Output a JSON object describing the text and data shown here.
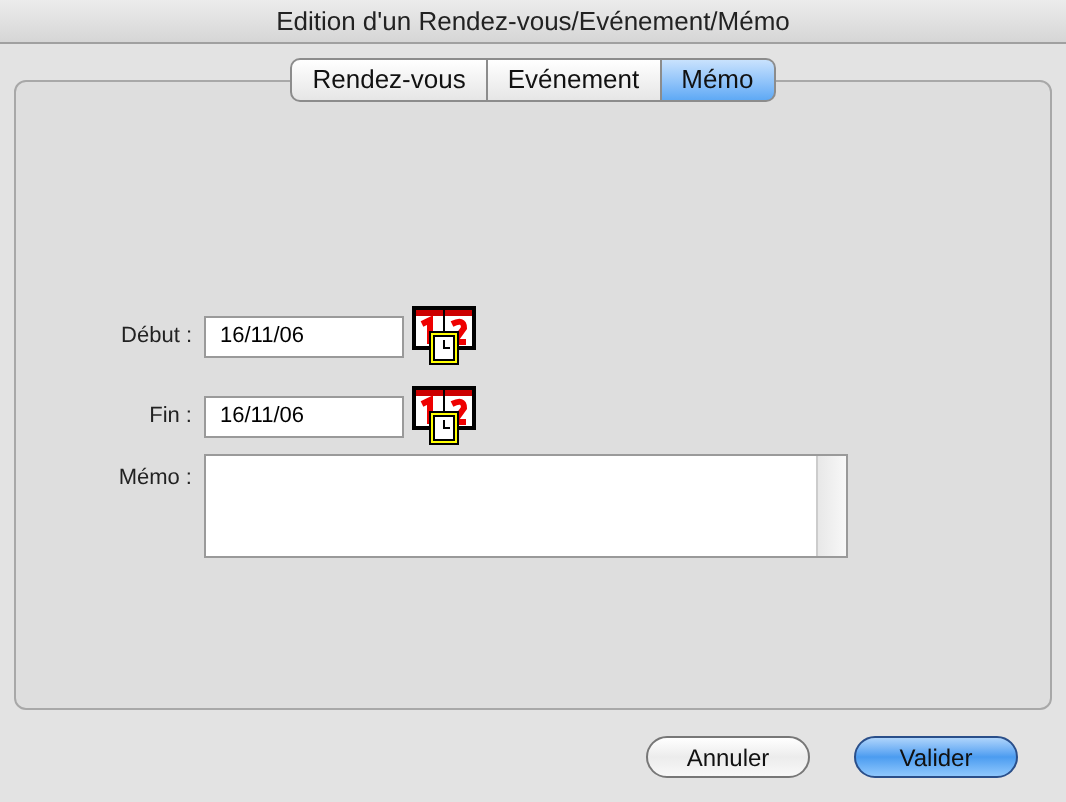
{
  "window": {
    "title": "Edition d'un Rendez-vous/Evénement/Mémo"
  },
  "tabs": [
    {
      "label": "Rendez-vous",
      "selected": false
    },
    {
      "label": "Evénement",
      "selected": false
    },
    {
      "label": "Mémo",
      "selected": true
    }
  ],
  "form": {
    "start": {
      "label": "Début :",
      "value": "16/11/06"
    },
    "end": {
      "label": "Fin :",
      "value": "16/11/06"
    },
    "memo": {
      "label": "Mémo :"
    }
  },
  "buttons": [
    {
      "label": "Annuler",
      "kind": "normal"
    },
    {
      "label": "Valider",
      "kind": "default"
    }
  ]
}
